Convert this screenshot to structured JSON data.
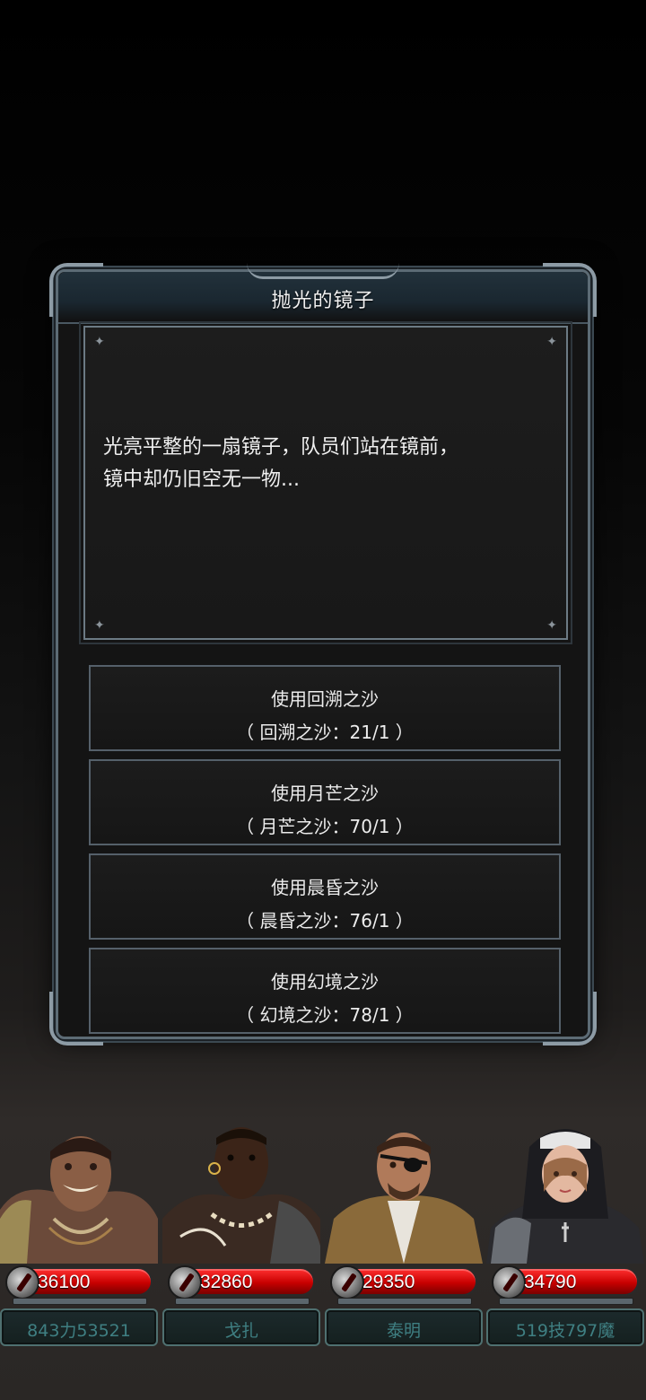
{
  "dialog": {
    "title": "抛光的镜子",
    "description_line1": "光亮平整的一扇镜子，队员们站在镜前，",
    "description_line2": "镜中却仍旧空无一物...",
    "options": [
      {
        "action": "使用回溯之沙",
        "detail": "（ 回溯之沙：21/1 ）"
      },
      {
        "action": "使用月芒之沙",
        "detail": "（ 月芒之沙：70/1 ）"
      },
      {
        "action": "使用晨昏之沙",
        "detail": "（ 晨昏之沙：76/1 ）"
      },
      {
        "action": "使用幻境之沙",
        "detail": "（ 幻境之沙：78/1 ）"
      }
    ]
  },
  "party": [
    {
      "hp": "36100",
      "name": "843力53521",
      "hp_icon": "sword-icon"
    },
    {
      "hp": "32860",
      "name": "戈扎",
      "hp_icon": "sword-icon"
    },
    {
      "hp": "29350",
      "name": "泰明",
      "hp_icon": "sword-icon"
    },
    {
      "hp": "34790",
      "name": "519技797魔",
      "hp_icon": "sword-icon"
    }
  ],
  "colors": {
    "hp_bar": "#d40000",
    "name_text": "#3f7f82",
    "frame": "#5c6b75"
  }
}
